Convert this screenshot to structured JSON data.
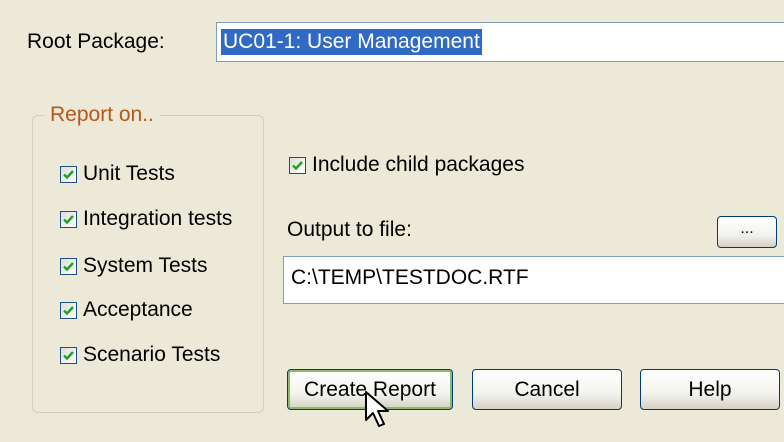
{
  "root_package": {
    "label": "Root Package:",
    "value": "UC01-1: User Management"
  },
  "report_on": {
    "title": "Report on..",
    "items": [
      {
        "label": "Unit Tests",
        "checked": true
      },
      {
        "label": "Integration tests",
        "checked": true
      },
      {
        "label": "System Tests",
        "checked": true
      },
      {
        "label": "Acceptance",
        "checked": true
      },
      {
        "label": "Scenario Tests",
        "checked": true
      }
    ]
  },
  "include_child": {
    "label": "Include child packages",
    "checked": true
  },
  "output": {
    "label": "Output to file:",
    "browse_label": "...",
    "value": "C:\\TEMP\\TESTDOC.RTF"
  },
  "buttons": {
    "create": "Create Report",
    "cancel": "Cancel",
    "help": "Help"
  },
  "colors": {
    "dialog_bg": "#ece9d8",
    "selection": "#316ac5",
    "group_title": "#b6561b",
    "checkmark": "#21a121"
  }
}
